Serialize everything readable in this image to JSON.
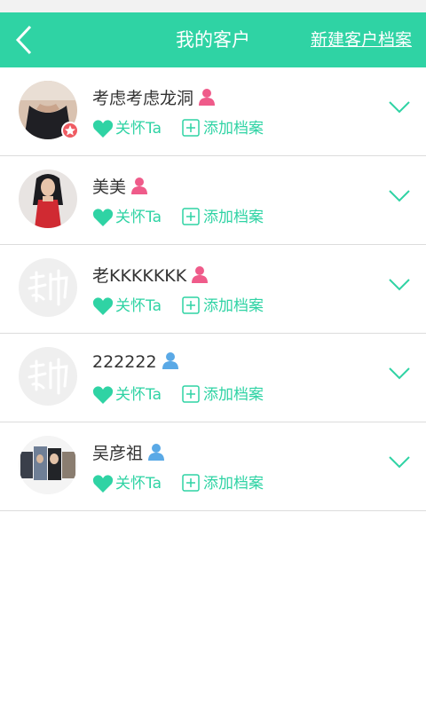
{
  "header": {
    "title": "我的客户",
    "action": "新建客户档案",
    "color": "#2fd3a4"
  },
  "actions": {
    "care_label": "关怀Ta",
    "add_file_label": "添加档案"
  },
  "customers": [
    {
      "name": "考虑考虑龙洞",
      "gender": "female",
      "avatar": "photo-woman-black-top",
      "starred": true
    },
    {
      "name": "美美",
      "gender": "female",
      "avatar": "photo-woman-red-dress",
      "starred": false
    },
    {
      "name": "老KKKKKKK",
      "gender": "female",
      "avatar": "default-avatar",
      "starred": false
    },
    {
      "name": "222222",
      "gender": "male",
      "avatar": "default-avatar",
      "starred": false
    },
    {
      "name": "吴彦祖",
      "gender": "male",
      "avatar": "photo-collage",
      "starred": false
    }
  ],
  "colors": {
    "accent": "#2fd3a4",
    "female": "#ef5b8a",
    "male": "#5aa9e6",
    "star_badge": "#ef5b62"
  }
}
